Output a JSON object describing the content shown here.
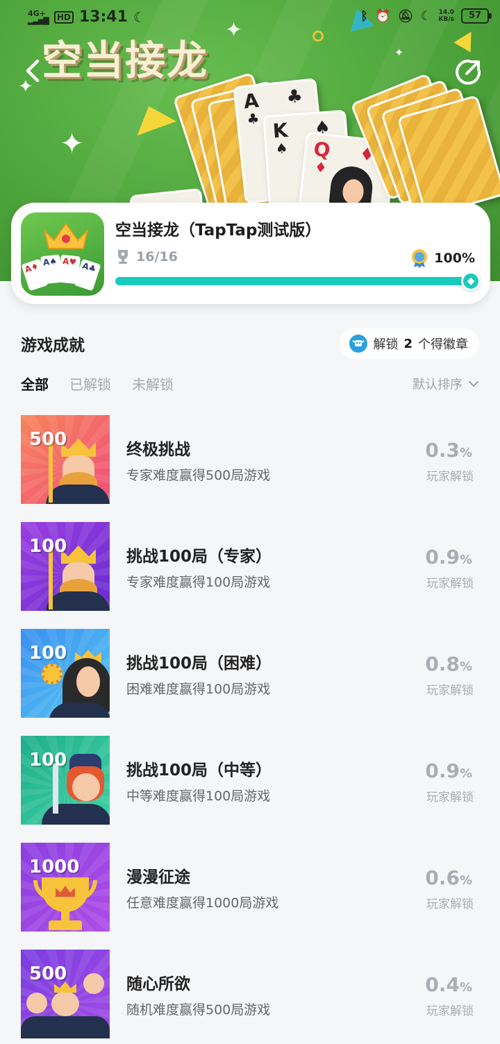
{
  "status_bar": {
    "network": "4G+",
    "hd": "HD",
    "time": "13:41",
    "speed_value": "14.0",
    "speed_unit": "KB/s",
    "battery": "57"
  },
  "header": {
    "title": "空当接龙",
    "back_icon": "chevron-left-icon",
    "share_icon": "share-icon",
    "card_ranks": [
      "A",
      "K",
      "Q"
    ]
  },
  "game": {
    "name": "空当接龙（TapTap测试版）",
    "achieved": "16/16",
    "percent_text": "100%",
    "progress": 1.0
  },
  "achievements_section": {
    "title": "游戏成就",
    "badge_prefix": "解锁",
    "badge_count": "2",
    "badge_suffix": "个得徽章",
    "tabs": [
      "全部",
      "已解锁",
      "未解锁"
    ],
    "active_tab": "全部",
    "sort_label": "默认排序"
  },
  "achievements": [
    {
      "badge_number": "500",
      "name": "终极挑战",
      "desc": "专家难度赢得500局游戏",
      "rate": "0.3",
      "unit": "%",
      "sub": "玩家解锁",
      "bg1": "#f7845a",
      "bg2": "#f04f7a",
      "art": "king"
    },
    {
      "badge_number": "100",
      "name": "挑战100局（专家）",
      "desc": "专家难度赢得100局游戏",
      "rate": "0.9",
      "unit": "%",
      "sub": "玩家解锁",
      "bg1": "#9b3fe0",
      "bg2": "#6a2bd0",
      "art": "king"
    },
    {
      "badge_number": "100",
      "name": "挑战100局（困难）",
      "desc": "困难难度赢得100局游戏",
      "rate": "0.8",
      "unit": "%",
      "sub": "玩家解锁",
      "bg1": "#3a8ff0",
      "bg2": "#56c8f2",
      "art": "queen"
    },
    {
      "badge_number": "100",
      "name": "挑战100局（中等）",
      "desc": "中等难度赢得100局游戏",
      "rate": "0.9",
      "unit": "%",
      "sub": "玩家解锁",
      "bg1": "#1fae8a",
      "bg2": "#3fd2a5",
      "art": "jack"
    },
    {
      "badge_number": "1000",
      "name": "漫漫征途",
      "desc": "任意难度赢得1000局游戏",
      "rate": "0.6",
      "unit": "%",
      "sub": "玩家解锁",
      "bg1": "#8a3fe0",
      "bg2": "#b04de6",
      "art": "trophy"
    },
    {
      "badge_number": "500",
      "name": "随心所欲",
      "desc": "随机难度赢得500局游戏",
      "rate": "0.4",
      "unit": "%",
      "sub": "玩家解锁",
      "bg1": "#7b3ce0",
      "bg2": "#a24ce6",
      "art": "trio"
    }
  ]
}
